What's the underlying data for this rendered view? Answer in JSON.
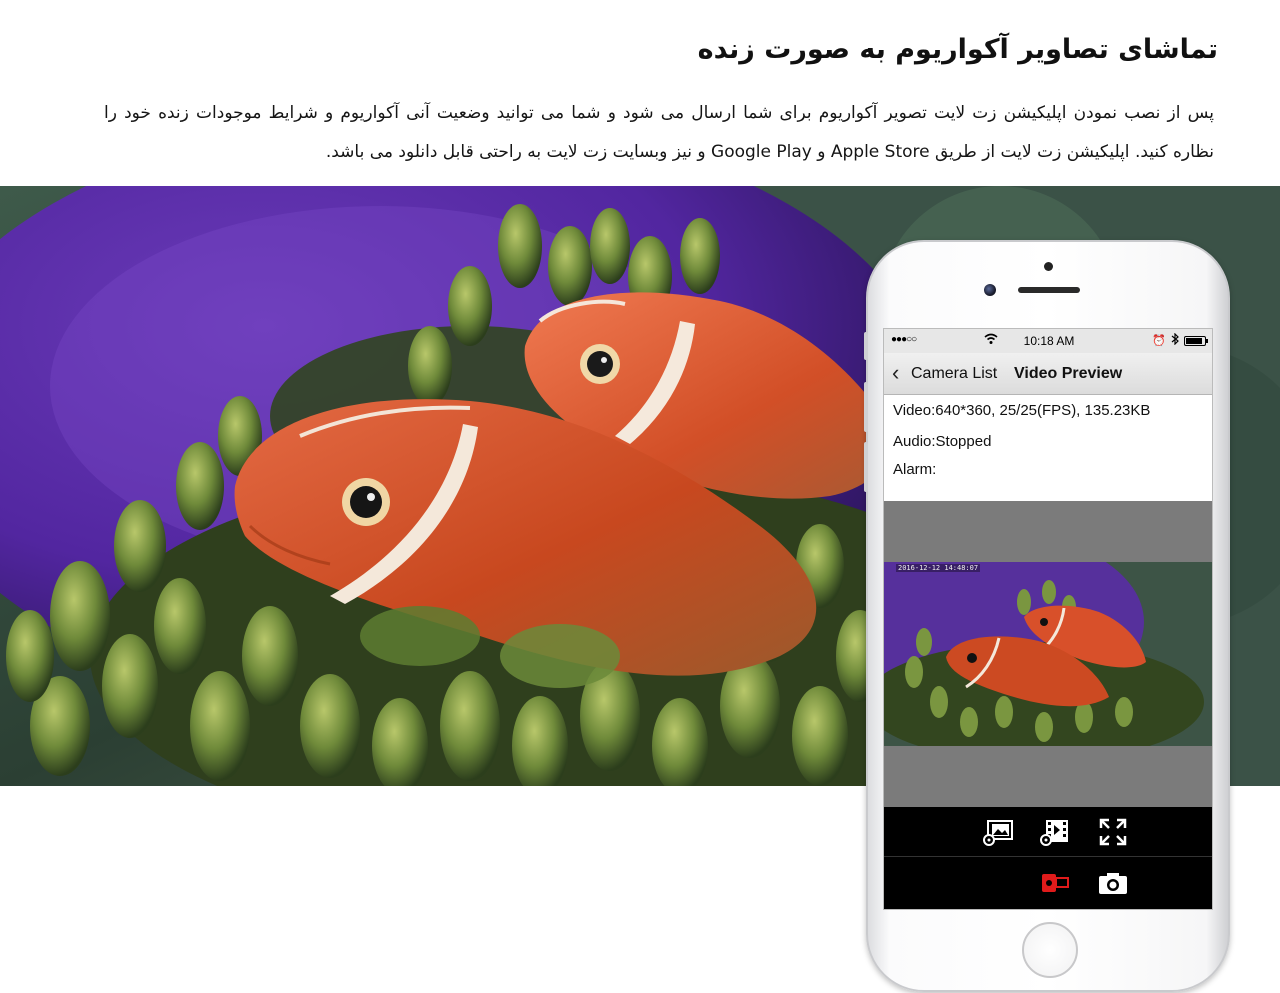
{
  "section": {
    "title": "تماشای تصاویر آکواریوم به صورت زنده",
    "paragraph": "پس از نصب نمودن اپلیکیشن زت لایت تصویر آکواریوم برای شما ارسال می شود و شما می توانید وضعیت آنی آکواریوم و شرایط موجودات زنده خود را نظاره کنید. اپلیکیشن زت لایت از طریق Apple Store و Google Play و نیز وبسایت زت لایت به راحتی قابل دانلود می باشد."
  },
  "phone": {
    "status_bar": {
      "signal": "●●●○○",
      "time": "10:18 AM",
      "icons": [
        "wifi-icon",
        "alarm-icon",
        "bluetooth-icon",
        "battery-icon"
      ]
    },
    "nav": {
      "back_label": "Camera List",
      "title": "Video Preview"
    },
    "info": {
      "video": "Video:640*360, 25/25(FPS), 135.23KB",
      "audio": "Audio:Stopped",
      "alarm": "Alarm:"
    },
    "video_timestamp": "2016-12-12 14:48:07",
    "controls": [
      {
        "name": "gallery-settings-icon"
      },
      {
        "name": "video-settings-icon"
      },
      {
        "name": "fullscreen-icon"
      },
      {
        "name": "record-video-icon",
        "color": "#e01b1b"
      },
      {
        "name": "snapshot-icon"
      }
    ]
  },
  "colors": {
    "accent_red": "#e01b1b",
    "control_bar": "#000000",
    "preview_bg": "#7b7b7b"
  }
}
